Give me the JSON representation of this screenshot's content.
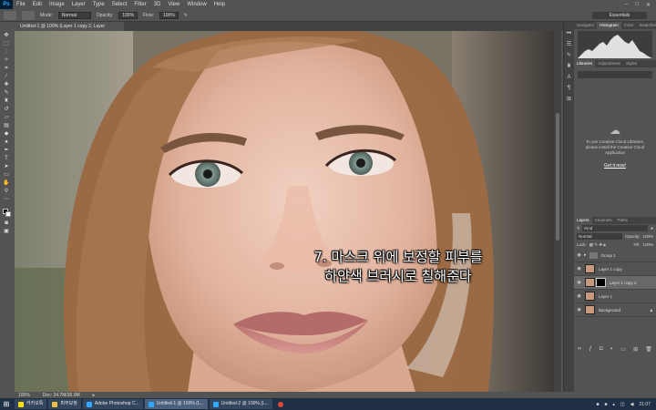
{
  "menubar": {
    "logo": "Ps",
    "items": [
      "File",
      "Edit",
      "Image",
      "Layer",
      "Type",
      "Select",
      "Filter",
      "3D",
      "View",
      "Window",
      "Help"
    ],
    "win_controls": [
      "–",
      "□",
      "✕"
    ]
  },
  "options": {
    "mode_label": "Mode:",
    "mode_value": "Normal",
    "opacity_label": "Opacity:",
    "opacity_value": "100%",
    "flow_label": "Flow:",
    "flow_value": "100%",
    "workspace": "Essentials"
  },
  "document": {
    "tab_title": "Untitled-1 @ 100% (Layer 1 copy 2, Layer Mask/8) *",
    "zoom": "100%",
    "doc_size": "Doc: 24.7M/36.9M",
    "caption_line1": "7. 마스크 위에 보정할 피부를",
    "caption_line2": "하얀색 브러시로 칠해준다"
  },
  "top_panel": {
    "tabs": [
      "Navigator",
      "Histogram",
      "Color",
      "Swatches"
    ],
    "active": "Histogram"
  },
  "libraries": {
    "tabs": [
      "Libraries",
      "Adjustments",
      "Styles"
    ],
    "message": "To use Creative Cloud Libraries, please install the Creative Cloud Application",
    "link": "Get it now!"
  },
  "layers_panel": {
    "tabs": [
      "Layers",
      "Channels",
      "Paths"
    ],
    "kind_label": "Kind",
    "blend_mode": "Normal",
    "opacity_label": "Opacity:",
    "opacity_value": "100%",
    "lock_label": "Lock:",
    "fill_label": "Fill:",
    "fill_value": "100%",
    "layers": [
      {
        "name": "Group 1",
        "type": "group"
      },
      {
        "name": "Layer 1 copy",
        "type": "pixel"
      },
      {
        "name": "Layer 1 copy 2",
        "type": "masked",
        "active": true
      },
      {
        "name": "Layer 1",
        "type": "pixel"
      },
      {
        "name": "Background",
        "type": "pixel"
      }
    ]
  },
  "taskbar": {
    "items": [
      {
        "label": "카카오톡",
        "color": "#f9e000"
      },
      {
        "label": "피부보정",
        "color": "#f0c040"
      },
      {
        "label": "Adobe Photoshop C...",
        "color": "#31a8ff"
      },
      {
        "label": "Untitled-1 @ 100% (L...",
        "color": "#31a8ff",
        "active": true
      },
      {
        "label": "Untitled-2 @ 100% (L...",
        "color": "#31a8ff"
      }
    ],
    "clock": "21:07"
  },
  "colors": {
    "ps_accent": "#31a8ff",
    "panel_bg": "#535353",
    "dark_bg": "#424242",
    "taskbar_bg": "#1f2f45"
  }
}
